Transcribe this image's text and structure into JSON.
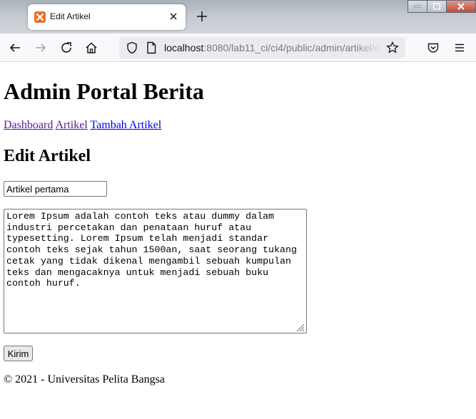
{
  "browser": {
    "tab_title": "Edit Artikel",
    "url_host": "localhost",
    "url_rest": ":8080/lab11_ci/ci4/public/admin/artikel/e",
    "accent_tab_icon": "#e8702a"
  },
  "page": {
    "heading": "Admin Portal Berita",
    "nav": [
      {
        "label": "Dashboard"
      },
      {
        "label": "Artikel"
      },
      {
        "label": "Tambah Artikel"
      }
    ],
    "form_heading": "Edit Artikel",
    "title_value": "Artikel pertama",
    "content_value": "Lorem Ipsum adalah contoh teks atau dummy dalam industri percetakan dan penataan huruf atau typesetting. Lorem Ipsum telah menjadi standar contoh teks sejak tahun 1500an, saat seorang tukang cetak yang tidak dikenal mengambil sebuah kumpulan teks dan mengacaknya untuk menjadi sebuah buku contoh huruf.",
    "submit_label": "Kirim",
    "footer": "© 2021 - Universitas Pelita Bangsa"
  }
}
